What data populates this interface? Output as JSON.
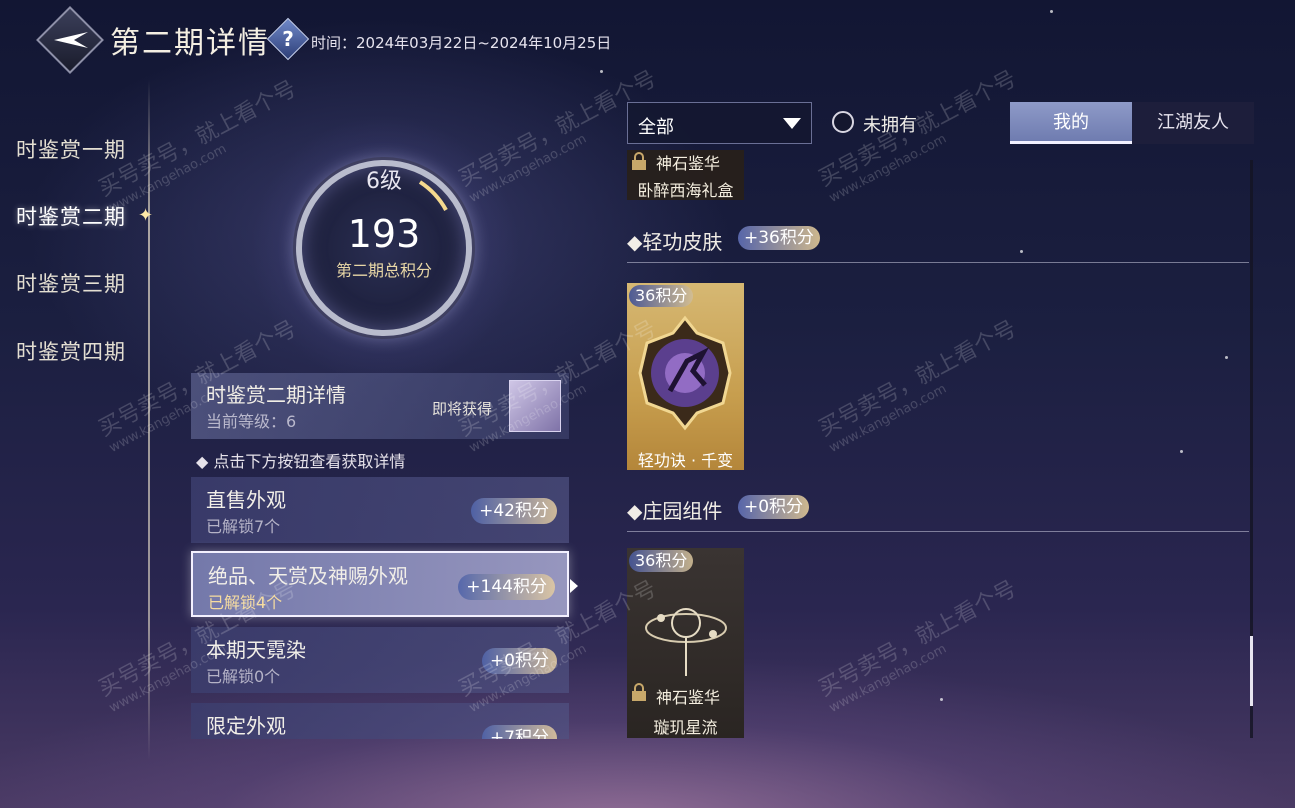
{
  "header": {
    "title": "第二期详情",
    "help_glyph": "?",
    "time_label": "时间：2024年03月22日~2024年10月25日"
  },
  "nav": {
    "items": [
      {
        "label": "时鉴赏一期",
        "active": false
      },
      {
        "label": "时鉴赏二期",
        "active": true
      },
      {
        "label": "时鉴赏三期",
        "active": false
      },
      {
        "label": "时鉴赏四期",
        "active": false
      }
    ]
  },
  "level_ring": {
    "level": "6级",
    "score": "193",
    "score_label": "第二期总积分"
  },
  "detail_card": {
    "title": "时鉴赏二期详情",
    "current_level": "当前等级：6",
    "soon": "即将获得"
  },
  "hint": "点击下方按钮查看获取详情",
  "categories": [
    {
      "name": "直售外观",
      "unlocked": "已解锁7个",
      "points": "+42积分",
      "selected": false
    },
    {
      "name": "绝品、天赏及神赐外观",
      "unlocked": "已解锁4个",
      "points": "+144积分",
      "selected": true
    },
    {
      "name": "本期天霓染",
      "unlocked": "已解锁0个",
      "points": "+0积分",
      "selected": false
    },
    {
      "name": "限定外观",
      "unlocked": "",
      "points": "+7积分",
      "selected": false
    }
  ],
  "filter": {
    "selected": "全部",
    "unowned_label": "未拥有"
  },
  "tabs": {
    "mine": "我的",
    "friends": "江湖友人"
  },
  "items": {
    "partial_card": {
      "tier": "神石鉴华",
      "name": "卧醉西海礼盒"
    },
    "sections": [
      {
        "title": "轻功皮肤",
        "points": "+36积分",
        "cards": [
          {
            "points": "36积分",
            "name": "轻功诀 · 千变"
          }
        ]
      },
      {
        "title": "庄园组件",
        "points": "+0积分",
        "cards": [
          {
            "points": "36积分",
            "tier": "神石鉴华",
            "name": "璇玑星流"
          }
        ]
      }
    ]
  },
  "watermark": {
    "line1": "买号卖号，就上看个号",
    "line2": "www.kangehao.com"
  },
  "colors": {
    "accent_gold": "#e8d7a6",
    "tab_active": "#8e9ac8",
    "background_top": "#121633"
  }
}
